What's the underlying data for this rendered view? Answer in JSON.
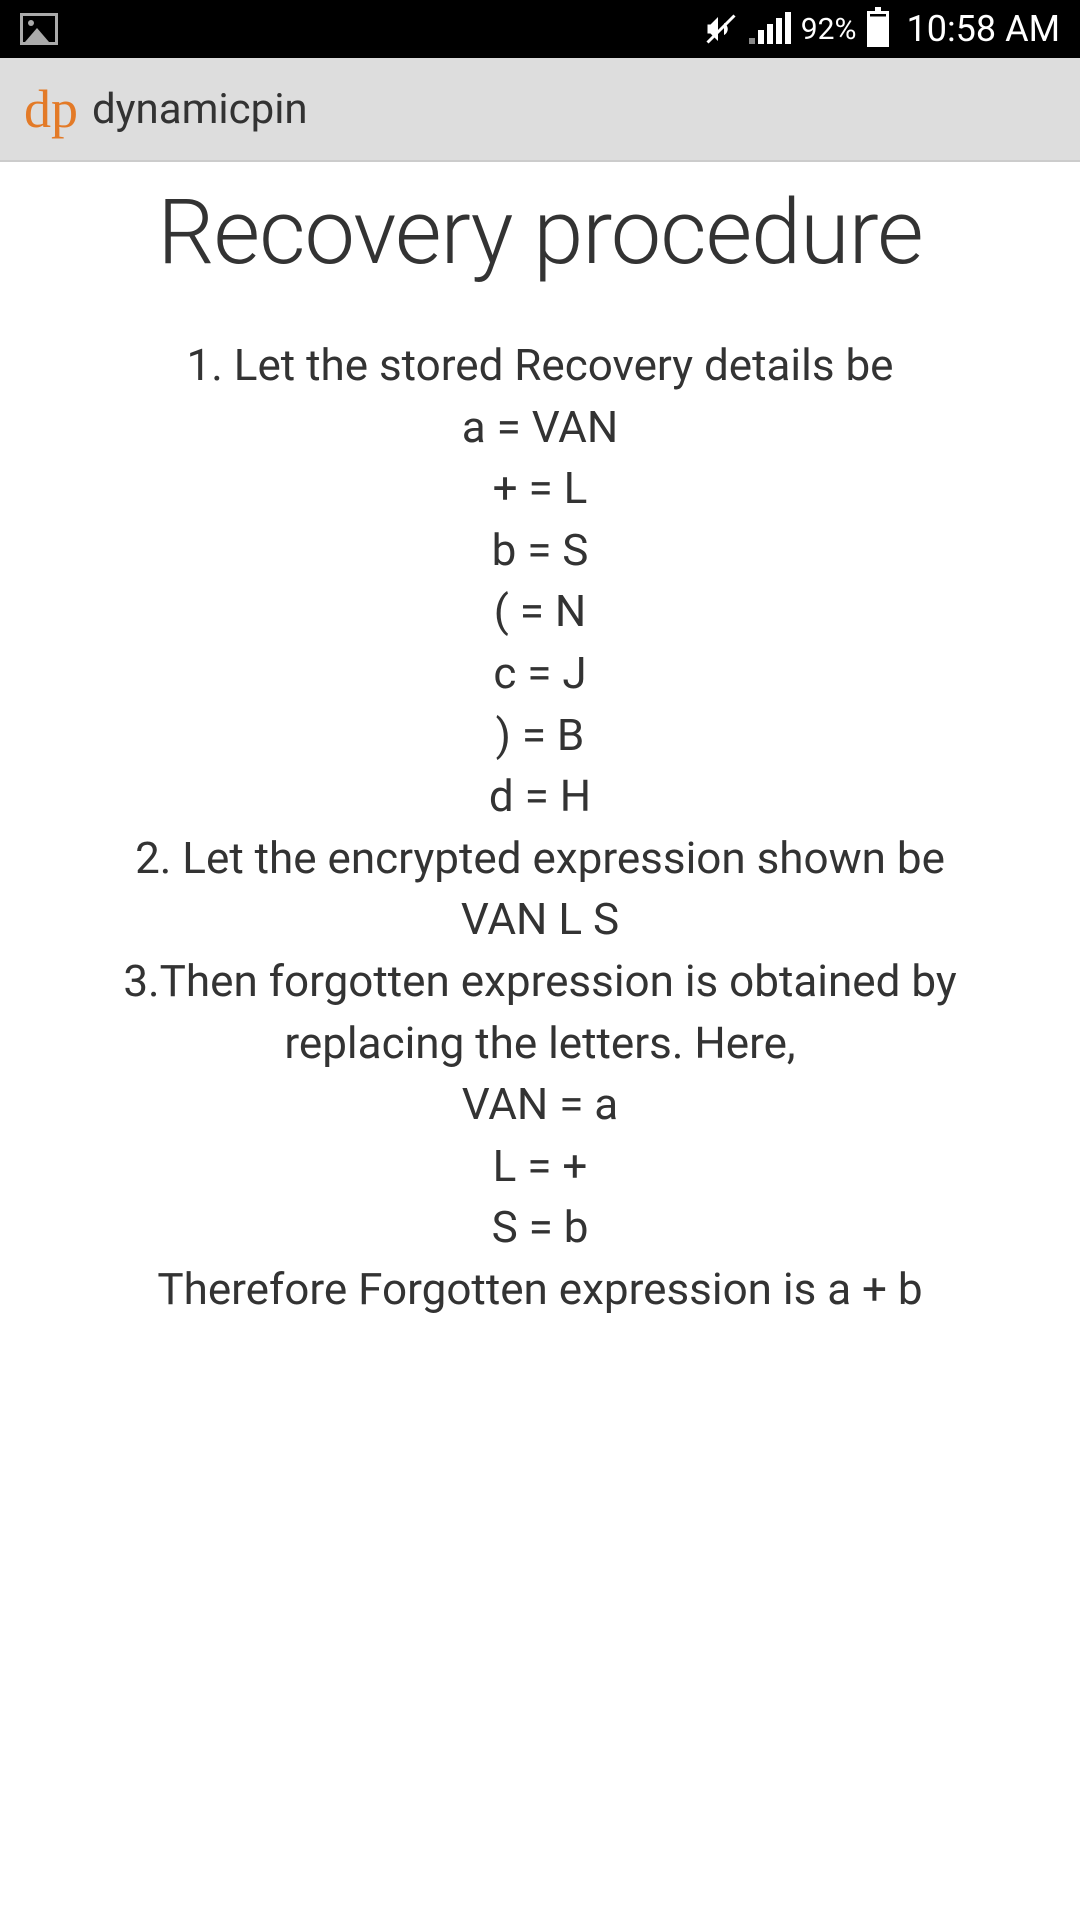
{
  "status": {
    "battery_pct": "92%",
    "time": "10:58 AM"
  },
  "appbar": {
    "logo": "dp",
    "name": "dynamicpin"
  },
  "page": {
    "title": "Recovery procedure",
    "step1": "1. Let the stored Recovery details be",
    "eq1": "a = VAN",
    "eq2": "+ = L",
    "eq3": "b = S",
    "eq4": "( = N",
    "eq5": "c = J",
    "eq6": ") = B",
    "eq7": "d = H",
    "step2": "2. Let the encrypted expression shown be",
    "expr": "VAN L S",
    "step3": "3.Then forgotten expression is obtained by replacing the letters. Here,",
    "r1": "VAN = a",
    "r2": "L  = +",
    "r3": "S   = b",
    "conclusion": "Therefore Forgotten expression is a + b"
  }
}
